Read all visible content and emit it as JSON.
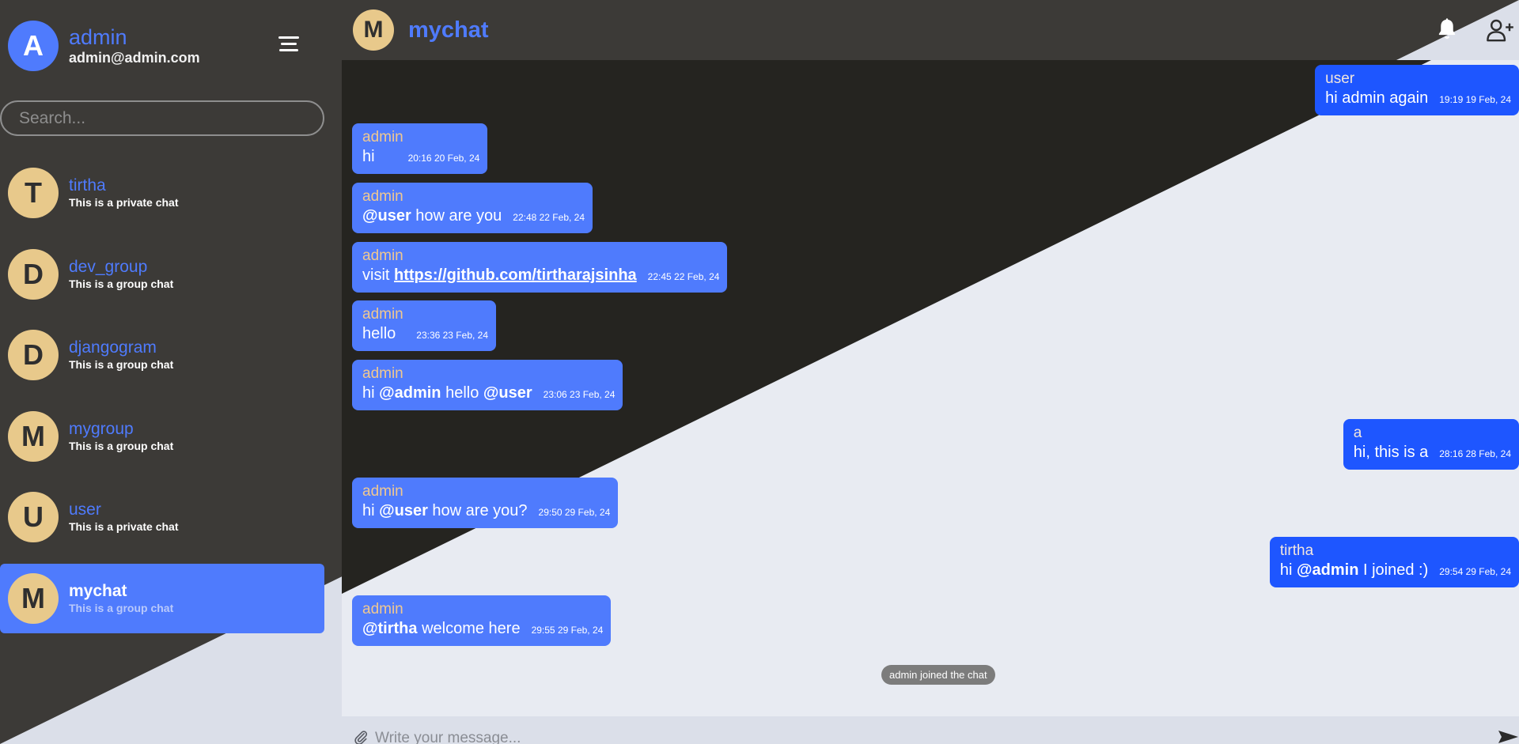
{
  "colors": {
    "accent": "#4f7bfd",
    "sent_bubble": "#1e56ff",
    "avatar_bg": "#e8c98b",
    "dark_bg": "#3c3a37",
    "panel_dark": "#252420",
    "panel_light": "#e8ebf2"
  },
  "profile": {
    "initial": "A",
    "name": "admin",
    "email": "admin@admin.com"
  },
  "search": {
    "placeholder": "Search..."
  },
  "chats": [
    {
      "initial": "T",
      "name": "tirtha",
      "desc": "This is a private chat"
    },
    {
      "initial": "D",
      "name": "dev_group",
      "desc": "This is a group chat"
    },
    {
      "initial": "D",
      "name": "djangogram",
      "desc": "This is a group chat"
    },
    {
      "initial": "M",
      "name": "mygroup",
      "desc": "This is a group chat"
    },
    {
      "initial": "U",
      "name": "user",
      "desc": "This is a private chat"
    },
    {
      "initial": "M",
      "name": "mychat",
      "desc": "This is a group chat",
      "active": true
    }
  ],
  "header": {
    "initial": "M",
    "title": "mychat"
  },
  "icons": {
    "menu": "hamburger-icon",
    "bell": "bell-icon",
    "add_user": "user-plus-icon",
    "attach": "paperclip-icon",
    "send": "send-icon"
  },
  "messages": [
    {
      "sender": "user",
      "text": "hi admin again",
      "time": "19:19 19 Feb, 24",
      "side": "right"
    },
    {
      "sender": "admin",
      "text": "hi",
      "time": "20:16 20 Feb, 24",
      "side": "left"
    },
    {
      "sender": "admin",
      "text": "@user how are you",
      "time": "22:48 22 Feb, 24",
      "side": "left"
    },
    {
      "sender": "admin",
      "text": "visit https://github.com/tirtharajsinha",
      "time": "22:45 22 Feb, 24",
      "side": "left"
    },
    {
      "sender": "admin",
      "text": "hello",
      "time": "23:36 23 Feb, 24",
      "side": "left"
    },
    {
      "sender": "admin",
      "text": "hi @admin hello @user",
      "time": "23:06 23 Feb, 24",
      "side": "left"
    },
    {
      "sender": "a",
      "text": "hi, this is a",
      "time": "28:16 28 Feb, 24",
      "side": "right"
    },
    {
      "sender": "admin",
      "text": "hi @user how are you?",
      "time": "29:50 29 Feb, 24",
      "side": "left"
    },
    {
      "sender": "tirtha",
      "text": "hi @admin I joined :)",
      "time": "29:54 29 Feb, 24",
      "side": "right"
    },
    {
      "sender": "admin",
      "text": "@tirtha welcome here",
      "time": "29:55 29 Feb, 24",
      "side": "left"
    }
  ],
  "system_message": "admin joined the chat",
  "composer": {
    "placeholder": "Write your message..."
  }
}
